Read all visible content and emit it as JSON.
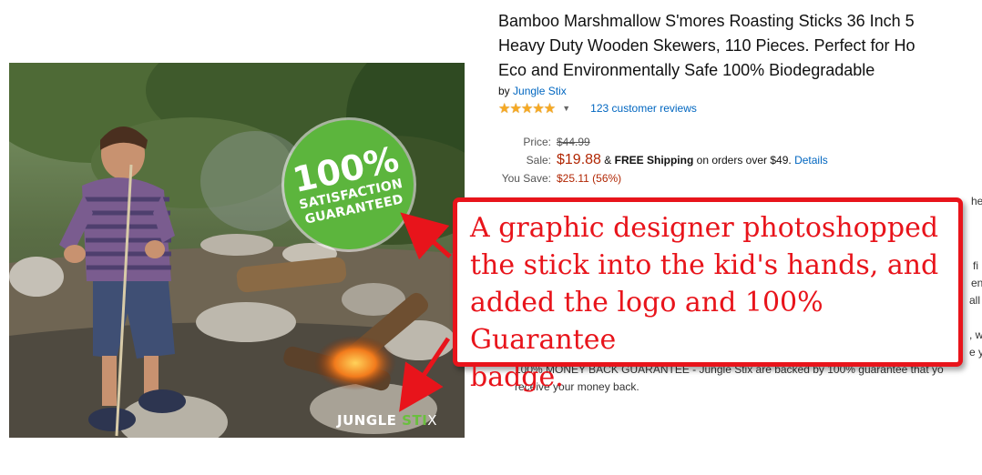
{
  "product": {
    "title_lines": [
      "Bamboo Marshmallow S'mores Roasting Sticks 36 Inch 5",
      "Heavy Duty Wooden Skewers, 110 Pieces. Perfect for Ho",
      "Eco and Environmentally Safe 100% Biodegradable"
    ],
    "by_prefix": "by",
    "brand": "Jungle Stix",
    "stars": "★★★★★",
    "reviews_link": "123 customer reviews",
    "price": {
      "list_label": "Price:",
      "list_value": "$44.99",
      "sale_label": "Sale:",
      "sale_value": "$19.88",
      "shipping_prefix": "&",
      "shipping_bold": "FREE Shipping",
      "shipping_suffix": "on orders over $49.",
      "details_link": "Details",
      "save_label": "You Save:",
      "save_value": "$25.11 (56%)"
    },
    "desc_fragments": [
      "he",
      "fi",
      "en",
      "all",
      ", w",
      "e y"
    ],
    "desc_partial": "100% MONEY BACK GUARANTEE - Jungle Stix are backed by 100% guarantee that yo",
    "desc_last": "receive your money back."
  },
  "image": {
    "badge_big": "100%",
    "badge_line1": "SATISFACTION",
    "badge_line2": "GUARANTEED",
    "logo_word": "JUNGLE",
    "logo_accent": "STI",
    "logo_x": "X"
  },
  "callout": {
    "lines": [
      "A graphic designer photoshopped",
      "the stick into the kid's hands, and",
      "added the logo and 100% Guarantee",
      "badge."
    ]
  },
  "colors": {
    "callout_red": "#e8141b",
    "link_blue": "#0066c0",
    "price_red": "#b12704",
    "badge_green": "#5cb53d",
    "star_gold": "#f6a923"
  },
  "icons": [
    "star-icon",
    "chevron-down-icon",
    "arrow-icon"
  ]
}
